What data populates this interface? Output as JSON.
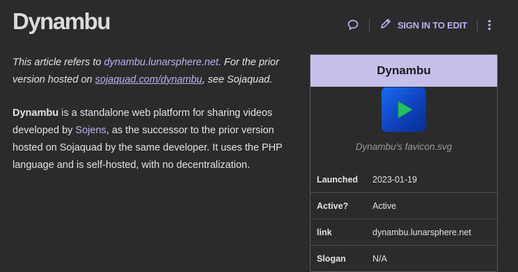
{
  "page": {
    "title": "Dynambu"
  },
  "toolbar": {
    "talk_icon": "speech-bubble-icon",
    "sign_in_label": "SIGN IN TO EDIT",
    "edit_icon": "pencil-icon",
    "more_icon": "kebab-menu-icon"
  },
  "hatnote": {
    "prefix": "This article refers to ",
    "link1": "dynambu.lunarsphere.net",
    "middle": ". For the prior version hosted on ",
    "link2": "sojaquad.com/dynambu",
    "suffix": ", see Sojaquad."
  },
  "intro": {
    "bold_name": "Dynambu",
    "text1": " is a standalone web platform for sharing videos developed by ",
    "link_sojens": "Sojens",
    "text2": ", as the successor to the prior version hosted on Sojaquad by the same developer. It uses the PHP language and is self-hosted, with no decentralization."
  },
  "infobox": {
    "title": "Dynambu",
    "image_icon": "play-icon",
    "caption": "Dynambu's favicon.svg",
    "rows": [
      {
        "label": "Launched",
        "value": "2023-01-19"
      },
      {
        "label": "Active?",
        "value": "Active"
      },
      {
        "label": "link",
        "value": "dynambu.lunarsphere.net"
      },
      {
        "label": "Slogan",
        "value": "N/A"
      }
    ]
  },
  "colors": {
    "background": "#2b2b2b",
    "link": "#b8b3f0",
    "infobox_header": "#c5c0ea",
    "favicon_blue": "#1a6cf2",
    "play_green": "#22c35e"
  }
}
